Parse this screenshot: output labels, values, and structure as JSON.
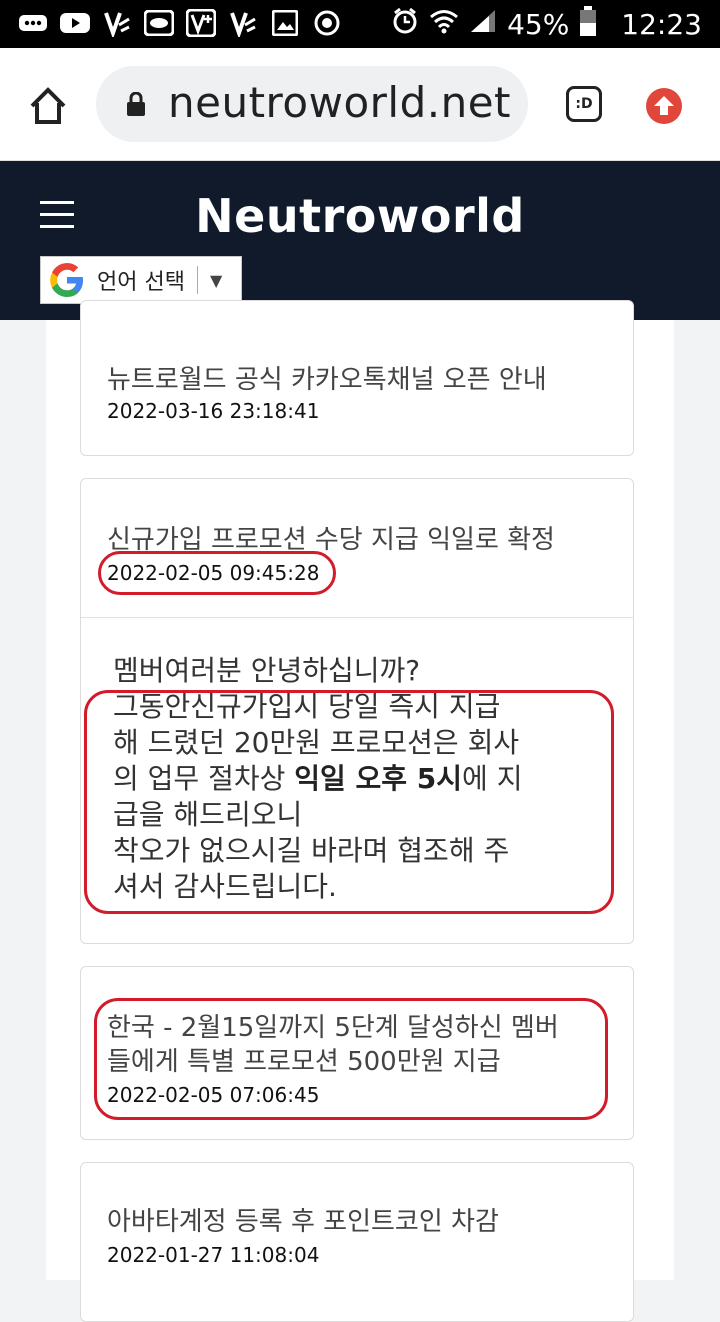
{
  "status_bar": {
    "battery_percent": "45%",
    "time": "12:23",
    "left_icons": [
      "more-icon",
      "youtube-icon",
      "vpn-icon",
      "app-icon",
      "vpn-plus-icon",
      "vpn-icon",
      "image-icon",
      "sync-icon"
    ],
    "right_icons": [
      "alarm-icon",
      "wifi-icon",
      "signal-icon",
      "battery-icon"
    ]
  },
  "browser": {
    "url": "neutroworld.net",
    "tab_button_label": ":D"
  },
  "site_header": {
    "brand": "Neutroworld",
    "language_selector": "언어 선택",
    "language_arrow": "▼"
  },
  "posts": [
    {
      "title": "뉴트로월드 공식 카카오톡채널 오픈 안내",
      "date": "2022-03-16 23:18:41"
    },
    {
      "title": "신규가입 프로모션 수당 지급 익일로 확정",
      "date": "2022-02-05 09:45:28",
      "body": {
        "line1": "멤버여러분 안녕하십니까?",
        "line2": "그동안신규가입시 당일 즉시 지급",
        "line3": "해 드렸던 20만원 프로모션은 회사",
        "line4_pre": "의 업무 절차상 ",
        "line4_bold": "익일 오후 5시",
        "line4_post": "에 지",
        "line5": "급을 해드리오니",
        "line6": "착오가 없으시길 바라며 협조해 주",
        "line7": "셔서 감사드립니다."
      }
    },
    {
      "title_line1": "한국 - 2월15일까지 5단계 달성하신 멤버",
      "title_line2": "들에게 특별 프로모션 500만원 지급",
      "date": "2022-02-05 07:06:45"
    },
    {
      "title": "아바타계정 등록 후 포인트코인 차감",
      "date": "2022-01-27 11:08:04"
    }
  ],
  "colors": {
    "header_bg": "#101a2b",
    "highlight_ring": "#d21b2b"
  }
}
